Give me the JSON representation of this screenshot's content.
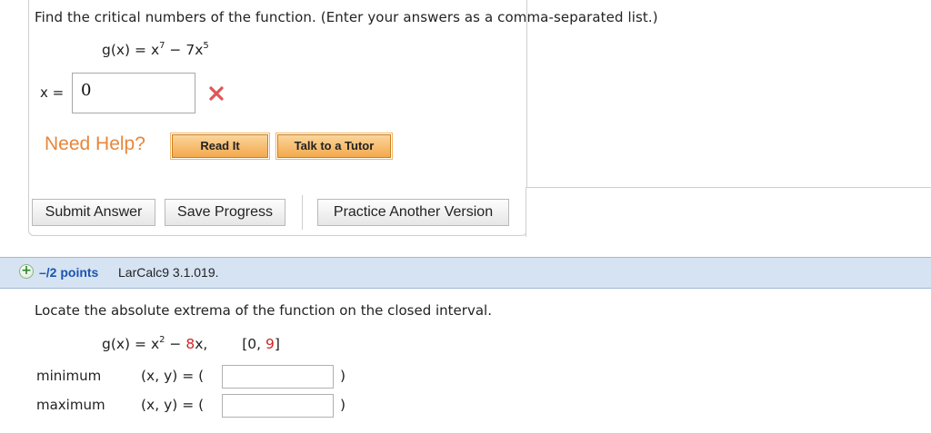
{
  "question1": {
    "prompt": "Find the critical numbers of the function. (Enter your answers as a comma-separated list.)",
    "function_lhs": "g(x) = x",
    "exp1": "7",
    "minus_term": " − 7x",
    "exp2": "5",
    "x_label": "x =",
    "answer_value": "0",
    "status": "incorrect"
  },
  "help": {
    "need_help_label": "Need Help?",
    "read_it_label": "Read It",
    "tutor_label": "Talk to a Tutor"
  },
  "actions": {
    "submit_label": "Submit Answer",
    "save_label": "Save Progress",
    "practice_label": "Practice Another Version"
  },
  "question2_header": {
    "points": "–/2 points",
    "problem_id": "LarCalc9 3.1.019."
  },
  "question2": {
    "prompt": "Locate the absolute extrema of the function on the closed interval.",
    "function_lhs": "g(x) = x",
    "exp": "2",
    "minus": " − ",
    "term_red": "8",
    "term_rest": "x,",
    "interval_open": "[0, ",
    "interval_red": "9",
    "interval_close": "]",
    "minimum_label": "minimum",
    "maximum_label": "maximum",
    "xy_label": "(x, y) = (",
    "close_paren": ")",
    "minimum_value": "",
    "maximum_value": ""
  },
  "colors": {
    "accent_orange": "#e8863a",
    "header_bar": "#d6e3f2",
    "points_blue": "#1a55b0",
    "error_red": "#d42222"
  }
}
